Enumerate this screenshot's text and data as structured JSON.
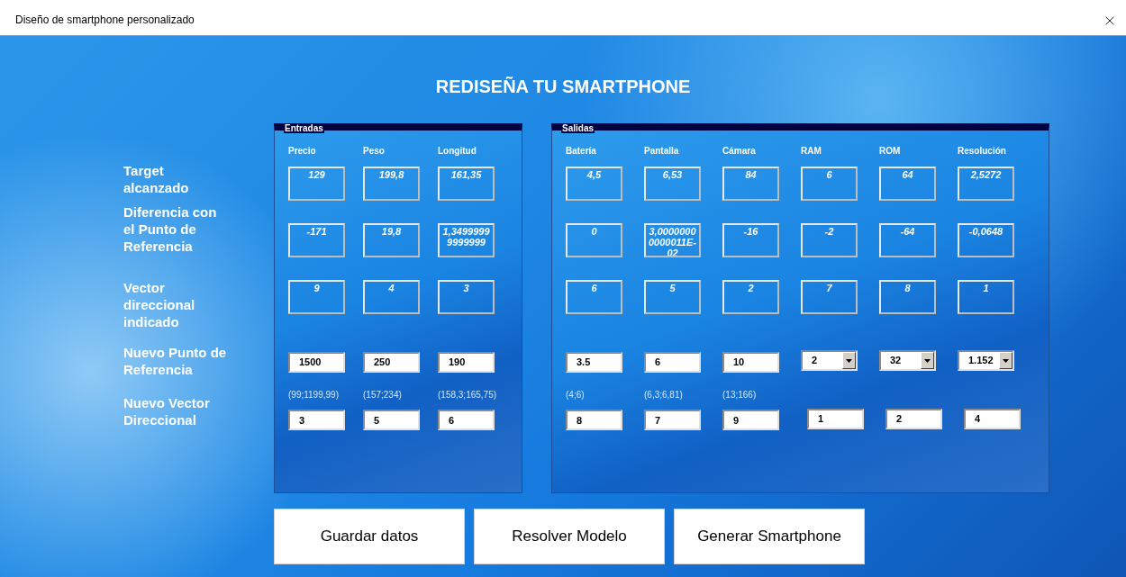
{
  "window": {
    "title": "Diseño de smartphone personalizado"
  },
  "heading": "REDISEÑA TU SMARTPHONE",
  "row_labels": [
    "Target alcanzado",
    "Diferencia con el Punto de Referencia",
    "Vector direccional indicado",
    "Nuevo Punto de Referencia",
    "Nuevo Vector Direccional"
  ],
  "panels": [
    {
      "title": "Entradas",
      "columns": [
        {
          "header": "Precio",
          "target": "129",
          "difference": "-171",
          "vector": "9",
          "reference": {
            "kind": "text",
            "value": "1500"
          },
          "range": "(99;1199,99)",
          "new_vector": "3"
        },
        {
          "header": "Peso",
          "target": "199,8",
          "difference": "19,8",
          "vector": "4",
          "reference": {
            "kind": "text",
            "value": "250"
          },
          "range": "(157;234)",
          "new_vector": "5"
        },
        {
          "header": "Longitud",
          "target": "161,35",
          "difference": "1,34999999999999",
          "vector": "3",
          "reference": {
            "kind": "text",
            "value": "190"
          },
          "range": "(158,3;165,75)",
          "new_vector": "6"
        }
      ]
    },
    {
      "title": "Salidas",
      "columns": [
        {
          "header": "Batería",
          "target": "4,5",
          "difference": "0",
          "vector": "6",
          "reference": {
            "kind": "text",
            "value": "3.5"
          },
          "range": "(4;6)",
          "new_vector": "8"
        },
        {
          "header": "Pantalla",
          "target": "6,53",
          "difference": "3,00000000000011E-02",
          "vector": "5",
          "reference": {
            "kind": "text",
            "value": "6"
          },
          "range": "(6,3;6,81)",
          "new_vector": "7"
        },
        {
          "header": "Cámara",
          "target": "84",
          "difference": "-16",
          "vector": "2",
          "reference": {
            "kind": "text",
            "value": "10"
          },
          "range": "(13;166)",
          "new_vector": "9"
        },
        {
          "header": "RAM",
          "target": "6",
          "difference": "-2",
          "vector": "7",
          "reference": {
            "kind": "dropdown",
            "value": "2"
          },
          "new_vector": "1"
        },
        {
          "header": "ROM",
          "target": "64",
          "difference": "-64",
          "vector": "8",
          "reference": {
            "kind": "dropdown",
            "value": "32"
          },
          "new_vector": "2"
        },
        {
          "header": "Resolución",
          "target": "2,5272",
          "difference": "-0,0648",
          "vector": "1",
          "reference": {
            "kind": "dropdown",
            "value": "1.152"
          },
          "new_vector": "4"
        }
      ]
    }
  ],
  "buttons": [
    "Guardar datos",
    "Resolver Modelo",
    "Generar Smartphone"
  ]
}
